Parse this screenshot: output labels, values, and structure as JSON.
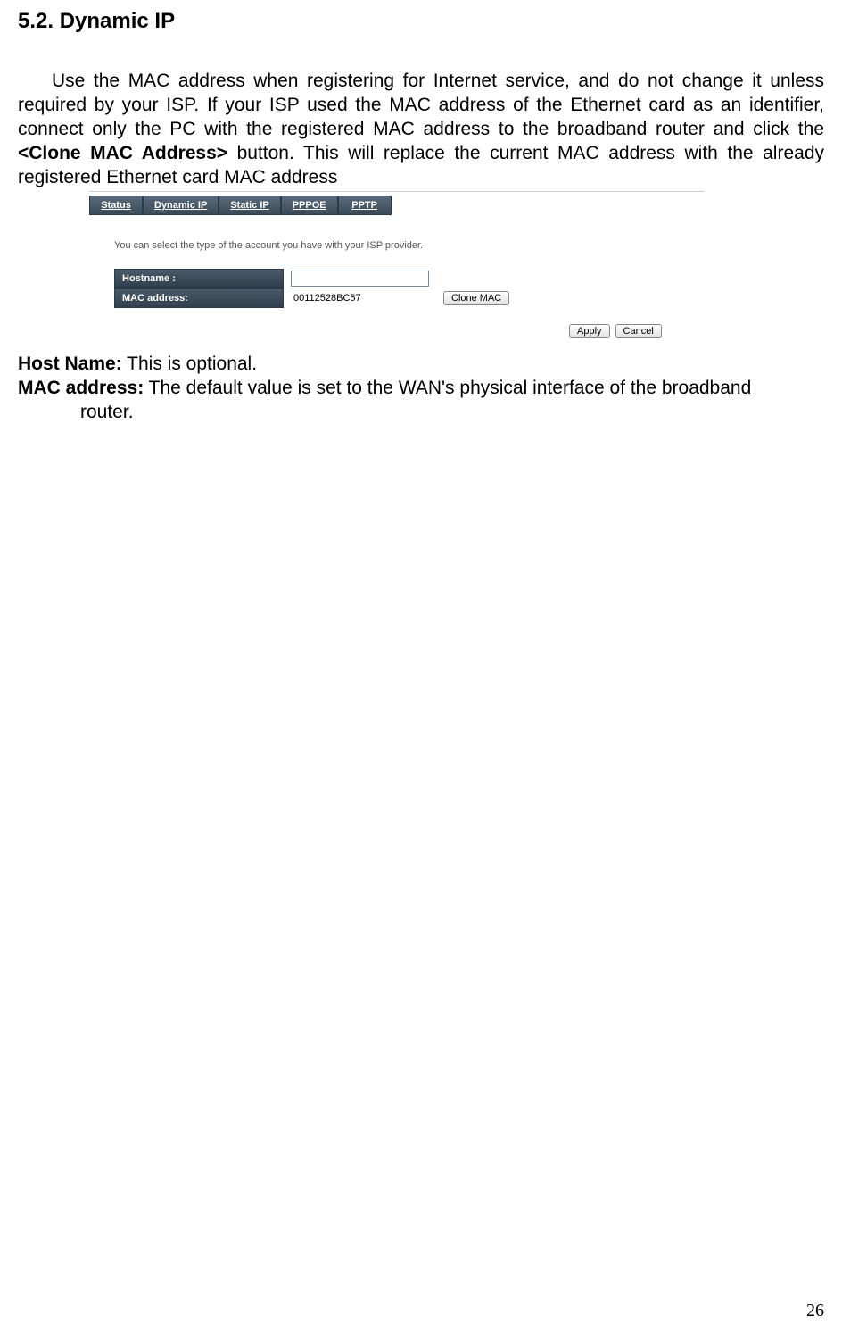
{
  "section": {
    "number": "5.2.",
    "title": "Dynamic IP"
  },
  "intro": {
    "part1": "Use the MAC address when registering for Internet service, and do not change it unless required by your ISP. If your ISP used the MAC address of the Ethernet card as an identifier, connect only the PC with the registered MAC address to the broadband router and click the ",
    "bold": "<Clone MAC Address>",
    "part2": " button. This will replace the current MAC address with the already registered Ethernet card MAC address"
  },
  "screenshot": {
    "tabs": [
      "Status",
      "Dynamic IP",
      "Static IP",
      "PPPOE",
      "PPTP"
    ],
    "desc": "You can select the type of the account you have with your ISP provider.",
    "hostname_label": "Hostname :",
    "hostname_value": "",
    "mac_label": "MAC address:",
    "mac_value": "00112528BC57",
    "clone_btn": "Clone MAC",
    "apply_btn": "Apply",
    "cancel_btn": "Cancel"
  },
  "defs": {
    "host_label": "Host Name:",
    "host_text": " This is optional.",
    "mac_label": "MAC address:",
    "mac_text_line1": " The default value is set to the WAN's physical interface of the broadband",
    "mac_text_line2": "router."
  },
  "page_number": "26"
}
